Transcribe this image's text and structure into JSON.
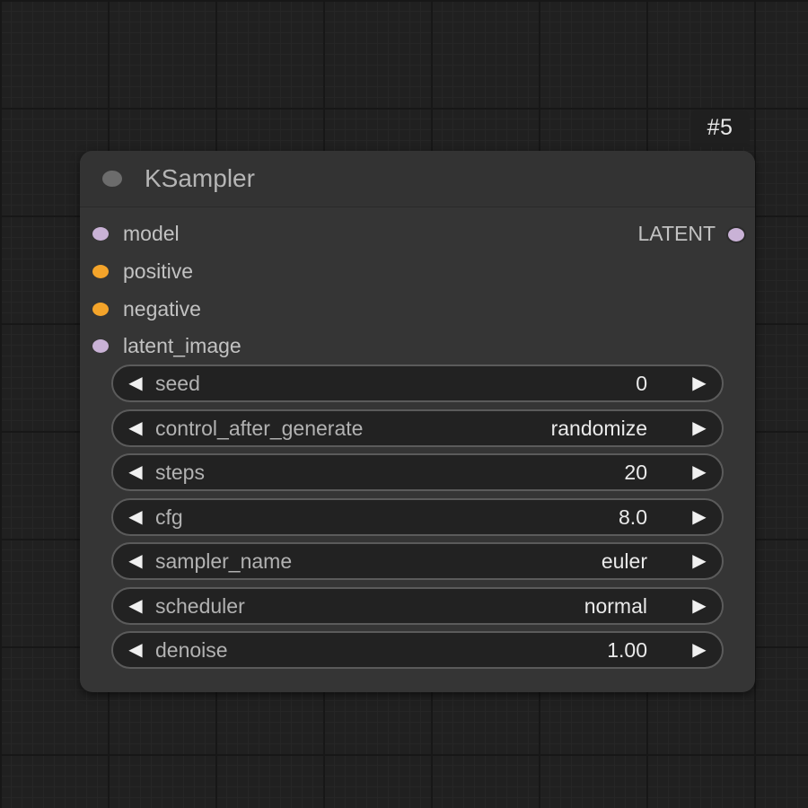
{
  "node": {
    "id_badge": "#5",
    "title": "KSampler",
    "inputs": [
      {
        "label": "model",
        "color": "#c9b2d6"
      },
      {
        "label": "positive",
        "color": "#f4a42a"
      },
      {
        "label": "negative",
        "color": "#f4a42a"
      },
      {
        "label": "latent_image",
        "color": "#c9b2d6"
      }
    ],
    "outputs": [
      {
        "label": "LATENT",
        "color": "#c9b2d6"
      }
    ],
    "widgets": [
      {
        "label": "seed",
        "value": "0"
      },
      {
        "label": "control_after_generate",
        "value": "randomize"
      },
      {
        "label": "steps",
        "value": "20"
      },
      {
        "label": "cfg",
        "value": "8.0"
      },
      {
        "label": "sampler_name",
        "value": "euler"
      },
      {
        "label": "scheduler",
        "value": "normal"
      },
      {
        "label": "denoise",
        "value": "1.00"
      }
    ],
    "arrow_left": "◀",
    "arrow_right": "▶"
  }
}
